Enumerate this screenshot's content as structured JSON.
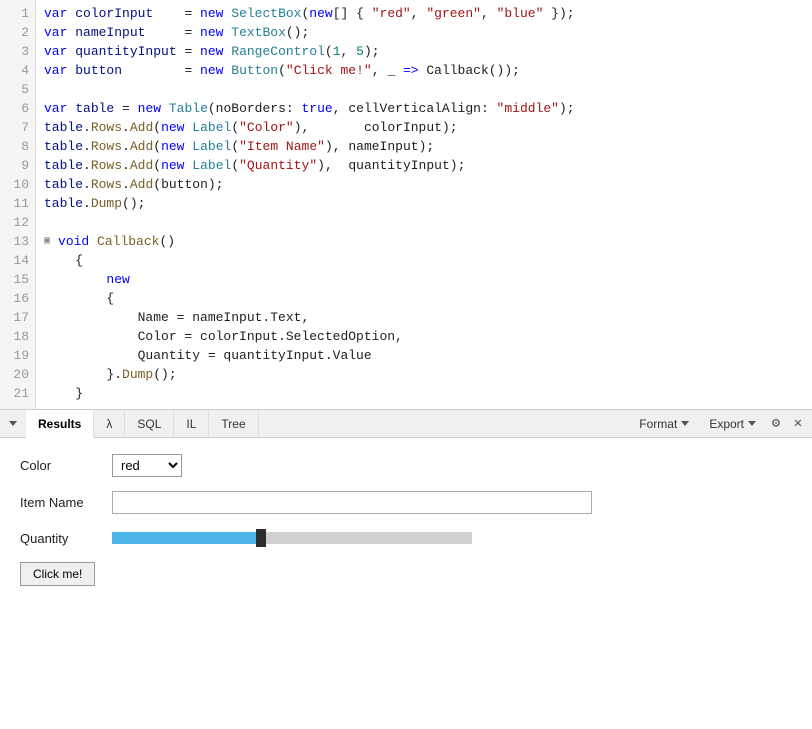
{
  "editor": {
    "lines": [
      {
        "num": 1,
        "indent": 0,
        "fold": false,
        "tokens": [
          {
            "t": "kw",
            "v": "var "
          },
          {
            "t": "prop",
            "v": "colorInput"
          },
          {
            "t": "plain",
            "v": "    = "
          },
          {
            "t": "kw",
            "v": "new "
          },
          {
            "t": "classname",
            "v": "SelectBox"
          },
          {
            "t": "plain",
            "v": "("
          },
          {
            "t": "kw",
            "v": "new"
          },
          {
            "t": "plain",
            "v": "[] { "
          },
          {
            "t": "str",
            "v": "\"red\""
          },
          {
            "t": "plain",
            "v": ", "
          },
          {
            "t": "str",
            "v": "\"green\""
          },
          {
            "t": "plain",
            "v": ", "
          },
          {
            "t": "str",
            "v": "\"blue\""
          },
          {
            "t": "plain",
            "v": " });"
          }
        ]
      },
      {
        "num": 2,
        "indent": 0,
        "fold": false,
        "tokens": [
          {
            "t": "kw",
            "v": "var "
          },
          {
            "t": "prop",
            "v": "nameInput"
          },
          {
            "t": "plain",
            "v": "     = "
          },
          {
            "t": "kw",
            "v": "new "
          },
          {
            "t": "classname",
            "v": "TextBox"
          },
          {
            "t": "plain",
            "v": "();"
          }
        ]
      },
      {
        "num": 3,
        "indent": 0,
        "fold": false,
        "tokens": [
          {
            "t": "kw",
            "v": "var "
          },
          {
            "t": "prop",
            "v": "quantityInput"
          },
          {
            "t": "plain",
            "v": " = "
          },
          {
            "t": "kw",
            "v": "new "
          },
          {
            "t": "classname",
            "v": "RangeControl"
          },
          {
            "t": "plain",
            "v": "("
          },
          {
            "t": "num",
            "v": "1"
          },
          {
            "t": "plain",
            "v": ", "
          },
          {
            "t": "num",
            "v": "5"
          },
          {
            "t": "plain",
            "v": ");"
          }
        ]
      },
      {
        "num": 4,
        "indent": 0,
        "fold": false,
        "tokens": [
          {
            "t": "kw",
            "v": "var "
          },
          {
            "t": "prop",
            "v": "button"
          },
          {
            "t": "plain",
            "v": "        = "
          },
          {
            "t": "kw",
            "v": "new "
          },
          {
            "t": "classname",
            "v": "Button"
          },
          {
            "t": "plain",
            "v": "("
          },
          {
            "t": "str",
            "v": "\"Click me!\""
          },
          {
            "t": "plain",
            "v": ", _ "
          },
          {
            "t": "arrow",
            "v": "=>"
          },
          {
            "t": "plain",
            "v": " Callback());"
          }
        ]
      },
      {
        "num": 5,
        "indent": 0,
        "fold": false,
        "tokens": [
          {
            "t": "plain",
            "v": ""
          }
        ]
      },
      {
        "num": 6,
        "indent": 0,
        "fold": false,
        "tokens": [
          {
            "t": "kw",
            "v": "var "
          },
          {
            "t": "prop",
            "v": "table"
          },
          {
            "t": "plain",
            "v": " = "
          },
          {
            "t": "kw",
            "v": "new "
          },
          {
            "t": "classname",
            "v": "Table"
          },
          {
            "t": "plain",
            "v": "(noBorders: "
          },
          {
            "t": "bool",
            "v": "true"
          },
          {
            "t": "plain",
            "v": ", cellVerticalAlign: "
          },
          {
            "t": "str",
            "v": "\"middle\""
          },
          {
            "t": "plain",
            "v": ");"
          }
        ]
      },
      {
        "num": 7,
        "indent": 0,
        "fold": false,
        "tokens": [
          {
            "t": "prop",
            "v": "table"
          },
          {
            "t": "plain",
            "v": "."
          },
          {
            "t": "method",
            "v": "Rows"
          },
          {
            "t": "plain",
            "v": "."
          },
          {
            "t": "method",
            "v": "Add"
          },
          {
            "t": "plain",
            "v": "("
          },
          {
            "t": "kw",
            "v": "new "
          },
          {
            "t": "classname",
            "v": "Label"
          },
          {
            "t": "plain",
            "v": "("
          },
          {
            "t": "str",
            "v": "\"Color\""
          },
          {
            "t": "plain",
            "v": "),       colorInput);"
          }
        ]
      },
      {
        "num": 8,
        "indent": 0,
        "fold": false,
        "tokens": [
          {
            "t": "prop",
            "v": "table"
          },
          {
            "t": "plain",
            "v": "."
          },
          {
            "t": "method",
            "v": "Rows"
          },
          {
            "t": "plain",
            "v": "."
          },
          {
            "t": "method",
            "v": "Add"
          },
          {
            "t": "plain",
            "v": "("
          },
          {
            "t": "kw",
            "v": "new "
          },
          {
            "t": "classname",
            "v": "Label"
          },
          {
            "t": "plain",
            "v": "("
          },
          {
            "t": "str",
            "v": "\"Item Name\""
          },
          {
            "t": "plain",
            "v": "), nameInput);"
          }
        ]
      },
      {
        "num": 9,
        "indent": 0,
        "fold": false,
        "tokens": [
          {
            "t": "prop",
            "v": "table"
          },
          {
            "t": "plain",
            "v": "."
          },
          {
            "t": "method",
            "v": "Rows"
          },
          {
            "t": "plain",
            "v": "."
          },
          {
            "t": "method",
            "v": "Add"
          },
          {
            "t": "plain",
            "v": "("
          },
          {
            "t": "kw",
            "v": "new "
          },
          {
            "t": "classname",
            "v": "Label"
          },
          {
            "t": "plain",
            "v": "("
          },
          {
            "t": "str",
            "v": "\"Quantity\""
          },
          {
            "t": "plain",
            "v": "),  quantityInput);"
          }
        ]
      },
      {
        "num": 10,
        "indent": 0,
        "fold": false,
        "tokens": [
          {
            "t": "prop",
            "v": "table"
          },
          {
            "t": "plain",
            "v": "."
          },
          {
            "t": "method",
            "v": "Rows"
          },
          {
            "t": "plain",
            "v": "."
          },
          {
            "t": "method",
            "v": "Add"
          },
          {
            "t": "plain",
            "v": "(button);"
          }
        ]
      },
      {
        "num": 11,
        "indent": 0,
        "fold": false,
        "tokens": [
          {
            "t": "prop",
            "v": "table"
          },
          {
            "t": "plain",
            "v": "."
          },
          {
            "t": "method",
            "v": "Dump"
          },
          {
            "t": "plain",
            "v": "();"
          }
        ]
      },
      {
        "num": 12,
        "indent": 0,
        "fold": false,
        "tokens": [
          {
            "t": "plain",
            "v": ""
          }
        ]
      },
      {
        "num": 13,
        "indent": 0,
        "fold": true,
        "tokens": [
          {
            "t": "kw",
            "v": "void "
          },
          {
            "t": "fn",
            "v": "Callback"
          },
          {
            "t": "plain",
            "v": "()"
          }
        ]
      },
      {
        "num": 14,
        "indent": 0,
        "fold": false,
        "tokens": [
          {
            "t": "plain",
            "v": "    {"
          }
        ]
      },
      {
        "num": 15,
        "indent": 1,
        "fold": false,
        "tokens": [
          {
            "t": "kw",
            "v": "        new"
          }
        ]
      },
      {
        "num": 16,
        "indent": 1,
        "fold": false,
        "tokens": [
          {
            "t": "plain",
            "v": "        {"
          }
        ]
      },
      {
        "num": 17,
        "indent": 2,
        "fold": false,
        "tokens": [
          {
            "t": "plain",
            "v": "            Name = nameInput.Text,"
          }
        ]
      },
      {
        "num": 18,
        "indent": 2,
        "fold": false,
        "tokens": [
          {
            "t": "plain",
            "v": "            Color = colorInput.SelectedOption,"
          }
        ]
      },
      {
        "num": 19,
        "indent": 2,
        "fold": false,
        "tokens": [
          {
            "t": "plain",
            "v": "            Quantity = quantityInput.Value"
          }
        ]
      },
      {
        "num": 20,
        "indent": 1,
        "fold": false,
        "tokens": [
          {
            "t": "plain",
            "v": "        }."
          },
          {
            "t": "method",
            "v": "Dump"
          },
          {
            "t": "plain",
            "v": "();"
          }
        ]
      },
      {
        "num": 21,
        "indent": 0,
        "fold": false,
        "tokens": [
          {
            "t": "plain",
            "v": "    }"
          }
        ]
      }
    ]
  },
  "tabs": {
    "items": [
      {
        "label": "Results",
        "active": true
      },
      {
        "label": "λ",
        "active": false
      },
      {
        "label": "SQL",
        "active": false
      },
      {
        "label": "IL",
        "active": false
      },
      {
        "label": "Tree",
        "active": false
      }
    ],
    "format_label": "Format",
    "export_label": "Export"
  },
  "results": {
    "color_label": "Color",
    "color_value": "red",
    "color_options": [
      "red",
      "green",
      "blue"
    ],
    "item_name_label": "Item Name",
    "item_name_value": "",
    "item_name_placeholder": "",
    "quantity_label": "Quantity",
    "quantity_filled_pct": 40,
    "click_button_label": "Click me!"
  }
}
